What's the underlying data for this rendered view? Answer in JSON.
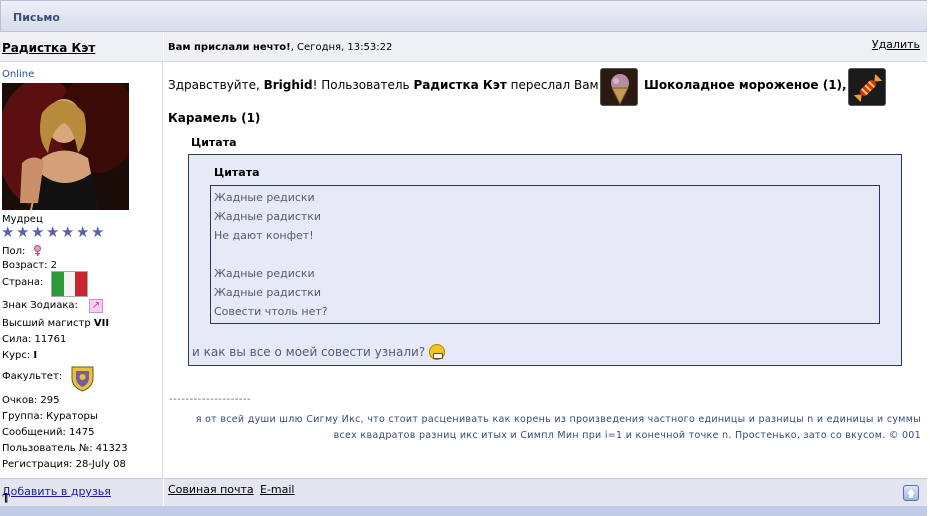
{
  "window": {
    "title": "Письмо"
  },
  "author": {
    "name": "Радистка Кэт",
    "status": "Online",
    "rank": "Мудрец",
    "stars": 7,
    "gender_label": "Пол:",
    "age": "Возраст: 2",
    "country_label": "Страна:",
    "zodiac_label": "Знак Зодиака:",
    "title_prefix": "Высший магистр",
    "title_level": "VII",
    "strength": "Сила: 11761",
    "course_label": "Курс:",
    "course_value": "I",
    "faculty_label": "Факультет:",
    "points": "Очков: 295",
    "group": "Группа: Кураторы",
    "messages": "Сообщений: 1475",
    "user_no": "Пользователь №: 41323",
    "registered": "Регистрация: 28-July 08",
    "add_friend_open": "[",
    "add_friend": "Добавить в друзья",
    "add_friend_close": "]"
  },
  "message": {
    "subject": "Вам прислали нечто!",
    "date": ", Сегодня, 13:53:22",
    "delete": "Удалить",
    "greet_1": "Здравствуйте,",
    "recipient": "Brighid",
    "greet_2": "! Пользователь",
    "sender": "Радистка Кэт",
    "greet_3": "переслал Вам",
    "gift1": "Шоколадное мороженое (1),",
    "gift2": "Карамель (1)",
    "quote_label_outer": "Цитата",
    "quote_label_inner": "Цитата",
    "quote_lines": [
      "Жадные редиски",
      "Жадные радистки",
      "Не дают конфет!",
      "",
      "Жадные редиски",
      "Жадные радистки",
      "Совести чтоль нет?"
    ],
    "reply": "и как вы все о моей совести узнали?"
  },
  "signature": {
    "separator": "--------------------",
    "text": "я от всей души шлю Сигму Икс, что стоит расценивать как корень из произведения частного единицы и разницы n и единицы и суммы всех квадратов разниц икс итых и Симпл Мин при i=1 и конечной точке n. Простенько, зато со вкусом. © 001"
  },
  "footer": {
    "owl_mail": "Совиная почта",
    "email": "E-mail"
  },
  "colors": {
    "accent": "#3a4e7a",
    "quote_bg": "#e6e9f6"
  },
  "icons": [
    "gender-female-icon",
    "italy-flag-icon",
    "zodiac-sagittarius-icon",
    "faculty-crest-icon",
    "ice-cream-icon",
    "candy-icon",
    "grin-smiley-icon",
    "scroll-up-icon"
  ]
}
